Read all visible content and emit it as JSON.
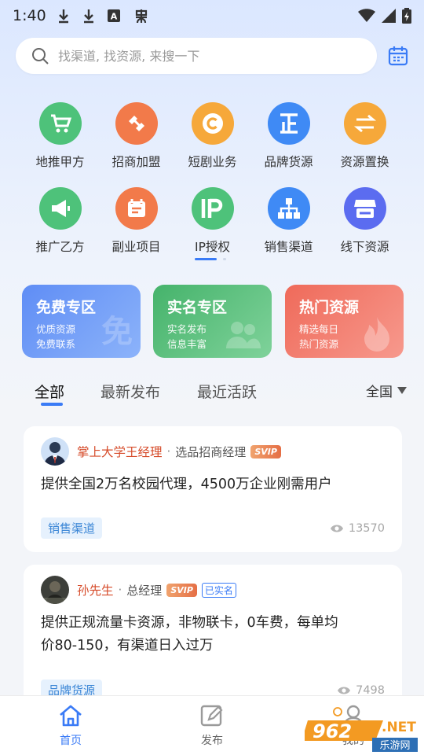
{
  "status_bar": {
    "time": "1:40",
    "icons": [
      "download-icon",
      "download-icon",
      "a-icon",
      "bug-icon"
    ],
    "right_icons": [
      "wifi-icon",
      "signal-icon",
      "battery-icon"
    ]
  },
  "search": {
    "placeholder": "找渠道, 找资源, 来搜一下"
  },
  "categories": [
    {
      "label": "地推甲方",
      "icon": "cart-icon",
      "color": "#4ec27a"
    },
    {
      "label": "招商加盟",
      "icon": "handshake-icon",
      "color": "#f27a4a"
    },
    {
      "label": "短剧业务",
      "icon": "copyright-icon",
      "color": "#f6a83a"
    },
    {
      "label": "品牌货源",
      "icon": "zheng-icon",
      "color": "#3f8af5"
    },
    {
      "label": "资源置换",
      "icon": "swap-icon",
      "color": "#f6a83a"
    },
    {
      "label": "推广乙方",
      "icon": "megaphone-icon",
      "color": "#4ec27a"
    },
    {
      "label": "副业项目",
      "icon": "calendar-icon",
      "color": "#f27a4a"
    },
    {
      "label": "IP授权",
      "icon": "ip-icon",
      "color": "#4ec27a"
    },
    {
      "label": "销售渠道",
      "icon": "network-icon",
      "color": "#3f8af5"
    },
    {
      "label": "线下资源",
      "icon": "store-icon",
      "color": "#5b6cf0"
    }
  ],
  "zones": [
    {
      "title": "免费专区",
      "line1": "优质资源",
      "line2": "免费联系",
      "watermark": "免",
      "color_from": "#5f8df5",
      "color_to": "#8cb3fa"
    },
    {
      "title": "实名专区",
      "line1": "实名发布",
      "line2": "信息丰富",
      "watermark": "",
      "color_from": "#45b36b",
      "color_to": "#7fd29a"
    },
    {
      "title": "热门资源",
      "line1": "精选每日",
      "line2": "热门资源",
      "watermark": "",
      "color_from": "#ef6a5a",
      "color_to": "#f7998d"
    }
  ],
  "tabs": [
    {
      "label": "全部",
      "active": true
    },
    {
      "label": "最新发布",
      "active": false
    },
    {
      "label": "最近活跃",
      "active": false
    }
  ],
  "region_filter": {
    "label": "全国"
  },
  "posts": [
    {
      "name": "掌上大学王经理",
      "role": "选品招商经理",
      "badge": "SVIP",
      "verified": "",
      "content_lines": [
        "提供全国2万名校园代理，4500万企业刚需用户"
      ],
      "tag": "销售渠道",
      "views": "13570"
    },
    {
      "name": "孙先生",
      "role": "总经理",
      "badge": "SVIP",
      "verified": "已实名",
      "content_lines": [
        "提供正规流量卡资源，非物联卡，0车费，每单均",
        "价80-150，有渠道日入过万"
      ],
      "tag": "品牌货源",
      "views": "7498"
    }
  ],
  "bottom_nav": [
    {
      "label": "首页",
      "icon": "home-icon",
      "active": true
    },
    {
      "label": "发布",
      "icon": "edit-icon",
      "active": false
    },
    {
      "label": "我的",
      "icon": "user-icon",
      "active": false
    }
  ],
  "watermark_logo": {
    "text1": "962",
    "text2": ".NET",
    "text3": "乐游网"
  },
  "colors": {
    "accent": "#3a7bf6",
    "name": "#d64b2a",
    "tag_bg": "#e6f1fd",
    "tag_text": "#3b86d6"
  }
}
